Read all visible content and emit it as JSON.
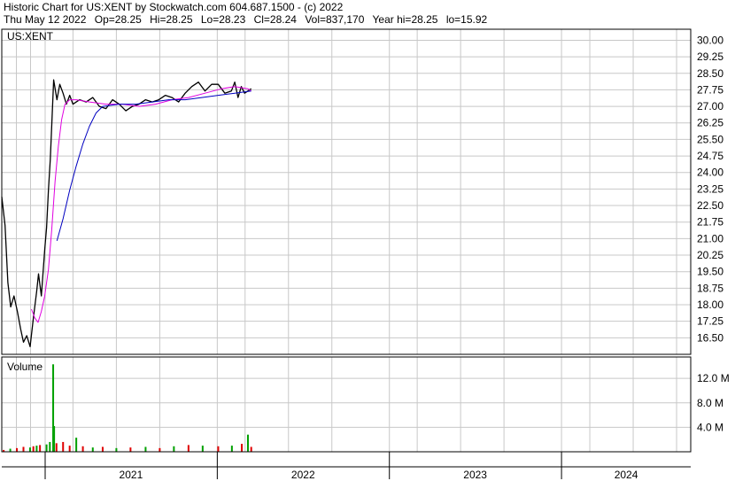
{
  "header": {
    "title": "Historic Chart for US:XENT by Stockwatch.com 604.687.1500 - (c) 2022",
    "date": "Thu May 12 2022",
    "op": "Op=28.25",
    "hi": "Hi=28.25",
    "lo": "Lo=28.23",
    "cl": "Cl=28.24",
    "vol": "Vol=837,170",
    "year_hi": "Year hi=28.25",
    "year_lo": "lo=15.92"
  },
  "chart_data": {
    "type": "line",
    "symbol_label": "US:XENT",
    "volume_label": "Volume",
    "price_axis": {
      "min": 15.75,
      "max": 30.5,
      "ticks": [
        16.5,
        17.25,
        18,
        18.75,
        19.5,
        20.25,
        21,
        21.75,
        22.5,
        23.25,
        24,
        24.75,
        25.5,
        26.25,
        27,
        27.75,
        28.5,
        29.25,
        30
      ],
      "tick_labels": [
        "16.50",
        "17.25",
        "18.00",
        "18.75",
        "19.50",
        "20.25",
        "21.00",
        "21.75",
        "22.50",
        "23.25",
        "24.00",
        "24.75",
        "25.50",
        "26.25",
        "27.00",
        "27.75",
        "28.50",
        "29.25",
        "30.00"
      ]
    },
    "volume_axis": {
      "unit": "M",
      "max": 15.5,
      "ticks": [
        4,
        8,
        12
      ],
      "tick_labels": [
        "4.0 M",
        "8.0 M",
        "12.0 M"
      ]
    },
    "time_axis": {
      "start": "2020-10-01",
      "end": "2024-10-01",
      "labels": [
        {
          "text": "2021",
          "date": "2021-01-01",
          "end": "2021-12-31"
        },
        {
          "text": "2022",
          "date": "2022-01-01",
          "end": "2022-12-31"
        },
        {
          "text": "2023",
          "date": "2023-01-01",
          "end": "2023-12-31"
        },
        {
          "text": "2024",
          "date": "2024-01-01",
          "end": "2024-10-01"
        }
      ],
      "gridline_dates": [
        "2020-11-01",
        "2020-12-01",
        "2021-01-01",
        "2021-03-01",
        "2021-06-01",
        "2021-09-01",
        "2022-01-01",
        "2022-03-01",
        "2022-06-01",
        "2022-09-01",
        "2023-01-01",
        "2023-03-01",
        "2023-06-01",
        "2023-09-01",
        "2024-01-01",
        "2024-03-01",
        "2024-06-01",
        "2024-09-01"
      ]
    },
    "grid": true,
    "colors": {
      "price": "#000000",
      "ma_short": "#e000e0",
      "ma_long": "#0000c0",
      "vol_up": "#00a000",
      "vol_down": "#e00000",
      "grid": "#c8c8c8"
    },
    "series": [
      {
        "key": "price",
        "points": [
          [
            "2020-10-01",
            22.9
          ],
          [
            "2020-10-08",
            21.6
          ],
          [
            "2020-10-14",
            19.0
          ],
          [
            "2020-10-20",
            17.9
          ],
          [
            "2020-10-27",
            18.4
          ],
          [
            "2020-11-03",
            17.7
          ],
          [
            "2020-11-10",
            16.9
          ],
          [
            "2020-11-16",
            16.3
          ],
          [
            "2020-11-23",
            16.6
          ],
          [
            "2020-11-30",
            16.1
          ],
          [
            "2020-12-07",
            17.4
          ],
          [
            "2020-12-14",
            18.6
          ],
          [
            "2020-12-18",
            19.4
          ],
          [
            "2020-12-24",
            18.4
          ],
          [
            "2020-12-31",
            20.5
          ],
          [
            "2021-01-04",
            21.5
          ],
          [
            "2021-01-08",
            23.2
          ],
          [
            "2021-01-12",
            24.6
          ],
          [
            "2021-01-19",
            28.2
          ],
          [
            "2021-01-26",
            27.3
          ],
          [
            "2021-02-01",
            28.0
          ],
          [
            "2021-02-08",
            27.6
          ],
          [
            "2021-02-15",
            27.1
          ],
          [
            "2021-02-22",
            27.5
          ],
          [
            "2021-03-01",
            27.1
          ],
          [
            "2021-03-15",
            27.3
          ],
          [
            "2021-03-29",
            27.2
          ],
          [
            "2021-04-12",
            27.4
          ],
          [
            "2021-04-26",
            27.0
          ],
          [
            "2021-05-10",
            26.9
          ],
          [
            "2021-05-24",
            27.3
          ],
          [
            "2021-06-07",
            27.1
          ],
          [
            "2021-06-21",
            26.8
          ],
          [
            "2021-07-05",
            27.0
          ],
          [
            "2021-07-19",
            27.1
          ],
          [
            "2021-08-02",
            27.3
          ],
          [
            "2021-08-16",
            27.2
          ],
          [
            "2021-08-30",
            27.3
          ],
          [
            "2021-09-13",
            27.5
          ],
          [
            "2021-09-27",
            27.4
          ],
          [
            "2021-10-11",
            27.2
          ],
          [
            "2021-10-25",
            27.6
          ],
          [
            "2021-11-08",
            27.9
          ],
          [
            "2021-11-22",
            28.1
          ],
          [
            "2021-12-06",
            27.7
          ],
          [
            "2021-12-20",
            28.0
          ],
          [
            "2022-01-03",
            28.0
          ],
          [
            "2022-01-17",
            27.6
          ],
          [
            "2022-01-31",
            27.7
          ],
          [
            "2022-02-07",
            28.1
          ],
          [
            "2022-02-14",
            27.4
          ],
          [
            "2022-02-21",
            27.9
          ],
          [
            "2022-02-28",
            27.6
          ],
          [
            "2022-03-07",
            27.7
          ],
          [
            "2022-03-14",
            27.8
          ]
        ]
      },
      {
        "key": "ma_short",
        "points": [
          [
            "2020-12-03",
            17.8
          ],
          [
            "2020-12-10",
            17.4
          ],
          [
            "2020-12-17",
            17.2
          ],
          [
            "2020-12-24",
            17.7
          ],
          [
            "2020-12-31",
            18.4
          ],
          [
            "2021-01-08",
            19.6
          ],
          [
            "2021-01-15",
            21.4
          ],
          [
            "2021-01-22",
            23.6
          ],
          [
            "2021-01-29",
            25.2
          ],
          [
            "2021-02-05",
            26.4
          ],
          [
            "2021-02-12",
            27.1
          ],
          [
            "2021-02-22",
            27.3
          ],
          [
            "2021-03-08",
            27.3
          ],
          [
            "2021-04-05",
            27.2
          ],
          [
            "2021-05-10",
            27.1
          ],
          [
            "2021-06-14",
            27.1
          ],
          [
            "2021-07-19",
            27.0
          ],
          [
            "2021-08-23",
            27.1
          ],
          [
            "2021-09-27",
            27.3
          ],
          [
            "2021-11-01",
            27.4
          ],
          [
            "2021-12-06",
            27.6
          ],
          [
            "2022-01-10",
            27.8
          ],
          [
            "2022-02-07",
            27.9
          ],
          [
            "2022-03-07",
            27.8
          ],
          [
            "2022-03-14",
            27.7
          ]
        ]
      },
      {
        "key": "ma_long",
        "points": [
          [
            "2021-01-26",
            20.9
          ],
          [
            "2021-02-08",
            21.9
          ],
          [
            "2021-02-22",
            23.2
          ],
          [
            "2021-03-08",
            24.3
          ],
          [
            "2021-03-22",
            25.3
          ],
          [
            "2021-04-05",
            26.1
          ],
          [
            "2021-04-19",
            26.7
          ],
          [
            "2021-05-03",
            27.0
          ],
          [
            "2021-06-07",
            27.1
          ],
          [
            "2021-07-12",
            27.1
          ],
          [
            "2021-08-16",
            27.2
          ],
          [
            "2021-09-20",
            27.3
          ],
          [
            "2021-10-25",
            27.3
          ],
          [
            "2021-11-29",
            27.4
          ],
          [
            "2022-01-03",
            27.5
          ],
          [
            "2022-02-07",
            27.6
          ],
          [
            "2022-03-14",
            27.7
          ]
        ]
      }
    ],
    "volume": [
      {
        "date": "2020-10-05",
        "value": 0.3,
        "up": false
      },
      {
        "date": "2020-10-19",
        "value": 0.5,
        "up": true
      },
      {
        "date": "2020-11-02",
        "value": 0.6,
        "up": false
      },
      {
        "date": "2020-11-16",
        "value": 0.8,
        "up": false
      },
      {
        "date": "2020-11-30",
        "value": 0.7,
        "up": true
      },
      {
        "date": "2020-12-07",
        "value": 0.9,
        "up": false
      },
      {
        "date": "2020-12-14",
        "value": 1.0,
        "up": true
      },
      {
        "date": "2020-12-21",
        "value": 1.1,
        "up": false
      },
      {
        "date": "2021-01-04",
        "value": 1.2,
        "up": true
      },
      {
        "date": "2021-01-11",
        "value": 1.6,
        "up": true
      },
      {
        "date": "2021-01-18",
        "value": 14.3,
        "up": true
      },
      {
        "date": "2021-01-20",
        "value": 4.2,
        "up": true
      },
      {
        "date": "2021-01-25",
        "value": 1.4,
        "up": false
      },
      {
        "date": "2021-02-08",
        "value": 1.6,
        "up": false
      },
      {
        "date": "2021-02-22",
        "value": 1.0,
        "up": false
      },
      {
        "date": "2021-03-08",
        "value": 2.3,
        "up": true
      },
      {
        "date": "2021-03-22",
        "value": 0.9,
        "up": false
      },
      {
        "date": "2021-04-12",
        "value": 0.7,
        "up": true
      },
      {
        "date": "2021-05-03",
        "value": 0.8,
        "up": false
      },
      {
        "date": "2021-06-01",
        "value": 0.6,
        "up": true
      },
      {
        "date": "2021-07-01",
        "value": 0.7,
        "up": false
      },
      {
        "date": "2021-08-02",
        "value": 0.8,
        "up": true
      },
      {
        "date": "2021-09-01",
        "value": 0.6,
        "up": false
      },
      {
        "date": "2021-10-01",
        "value": 0.9,
        "up": true
      },
      {
        "date": "2021-11-01",
        "value": 1.1,
        "up": false
      },
      {
        "date": "2021-12-01",
        "value": 1.0,
        "up": true
      },
      {
        "date": "2022-01-03",
        "value": 0.9,
        "up": false
      },
      {
        "date": "2022-02-01",
        "value": 1.0,
        "up": true
      },
      {
        "date": "2022-02-22",
        "value": 1.3,
        "up": false
      },
      {
        "date": "2022-03-07",
        "value": 2.8,
        "up": true
      },
      {
        "date": "2022-03-14",
        "value": 0.8,
        "up": false
      }
    ]
  }
}
